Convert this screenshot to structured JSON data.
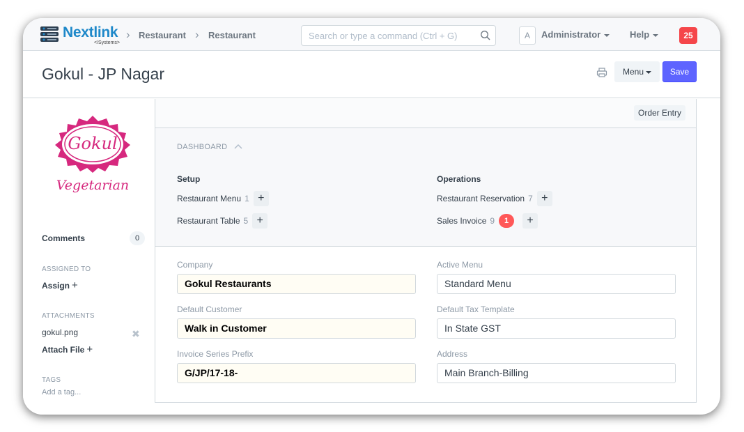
{
  "navbar": {
    "brand": "Nextlink",
    "brand_sub": "</Systems>",
    "breadcrumbs": [
      "Restaurant",
      "Restaurant"
    ],
    "search_placeholder": "Search or type a command (Ctrl + G)",
    "avatar_letter": "A",
    "user": "Administrator",
    "help": "Help",
    "notifications": "25"
  },
  "page": {
    "title": "Gokul - JP Nagar",
    "menu_label": "Menu",
    "save_label": "Save"
  },
  "sidebar": {
    "logo_text_top": "Gokul",
    "logo_text_bottom": "Vegetarian",
    "comments_label": "Comments",
    "comments_count": "0",
    "assigned_label": "ASSIGNED TO",
    "assign_label": "Assign",
    "attachments_label": "ATTACHMENTS",
    "attachment_file": "gokul.png",
    "attach_label": "Attach File",
    "tags_label": "TAGS",
    "add_tag": "Add a tag..."
  },
  "toolbar": {
    "order_entry": "Order Entry"
  },
  "dashboard": {
    "title": "DASHBOARD",
    "groups": [
      {
        "title": "Setup",
        "links": [
          {
            "label": "Restaurant Menu",
            "count": "1"
          },
          {
            "label": "Restaurant Table",
            "count": "5"
          }
        ]
      },
      {
        "title": "Operations",
        "links": [
          {
            "label": "Restaurant Reservation",
            "count": "7"
          },
          {
            "label": "Sales Invoice",
            "count": "9",
            "badge": "1"
          }
        ]
      }
    ]
  },
  "form": {
    "company_label": "Company",
    "company_value": "Gokul Restaurants",
    "default_customer_label": "Default Customer",
    "default_customer_value": "Walk in Customer",
    "invoice_prefix_label": "Invoice Series Prefix",
    "invoice_prefix_value": "G/JP/17-18-",
    "active_menu_label": "Active Menu",
    "active_menu_value": "Standard Menu",
    "tax_template_label": "Default Tax Template",
    "tax_template_value": "In State GST",
    "address_label": "Address",
    "address_value": "Main Branch-Billing"
  },
  "colors": {
    "brand_blue": "#1e88c9",
    "primary": "#5e64ff",
    "notification_red": "#f5464a",
    "logo_magenta": "#d6287e"
  }
}
